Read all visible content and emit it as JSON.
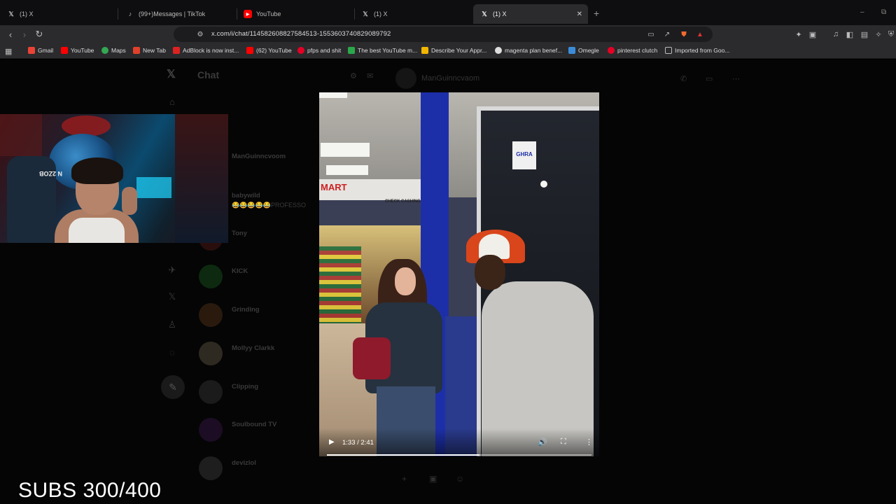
{
  "browser": {
    "tabs": [
      {
        "label": "(1) X",
        "icon": "x-logo-icon",
        "active": false
      },
      {
        "label": "(99+)Messages | TikTok",
        "icon": "tiktok-icon",
        "active": false
      },
      {
        "label": "YouTube",
        "icon": "youtube-icon",
        "active": false
      },
      {
        "label": "(1) X",
        "icon": "x-logo-icon",
        "active": false
      },
      {
        "label": "(1) X",
        "icon": "x-logo-icon",
        "active": true
      }
    ],
    "new_tab_symbol": "+",
    "url": "x.com/i/chat/1145826088275845​13-1553603740829089792",
    "bookmarks": [
      {
        "label": "Gmail",
        "color": "#ea4335"
      },
      {
        "label": "YouTube",
        "color": "#ff0000"
      },
      {
        "label": "Maps",
        "color": "#34a853"
      },
      {
        "label": "New Tab",
        "color": "#e0412a"
      },
      {
        "label": "AdBlock is now inst...",
        "color": "#d22"
      },
      {
        "label": "(62) YouTube",
        "color": "#ff0000"
      },
      {
        "label": "pfps and shit",
        "color": "#e60023"
      },
      {
        "label": "The best YouTube m...",
        "color": "#2ba84a"
      },
      {
        "label": "Describe Your Appr...",
        "color": "#f2b600"
      },
      {
        "label": "magenta plan benef...",
        "color": "#dddddd"
      },
      {
        "label": "Omegle",
        "color": "#3b8cd8"
      },
      {
        "label": "pinterest clutch",
        "color": "#e60023"
      },
      {
        "label": "Imported from Goo...",
        "color": "#bbbbbb"
      }
    ]
  },
  "x_page": {
    "chat_title": "Chat",
    "conversation_name": "ManGuinncvaom",
    "chats": [
      {
        "name": "ManGuinncvoom",
        "preview": ""
      },
      {
        "name": "babywild",
        "preview": "😂😂😂😂😂PROFESSO"
      },
      {
        "name": "Tony",
        "preview": ""
      },
      {
        "name": "KICK",
        "preview": ""
      },
      {
        "name": "Grinding",
        "preview": ""
      },
      {
        "name": "Mollyy Clarkk",
        "preview": ""
      },
      {
        "name": "Clipping",
        "preview": ""
      },
      {
        "name": "Soulbound TV",
        "preview": ""
      },
      {
        "name": "devizlol",
        "preview": ""
      }
    ]
  },
  "webcam": {
    "chair_text": "N 2ZOB"
  },
  "video": {
    "time": "1:33 / 2:41",
    "progress": 0.578,
    "store_sign": "MART",
    "cashier_sign": "CHECK CASHING",
    "door_sign": "GHRA"
  },
  "overlay": {
    "subs_text": "SUBS 300/400"
  }
}
